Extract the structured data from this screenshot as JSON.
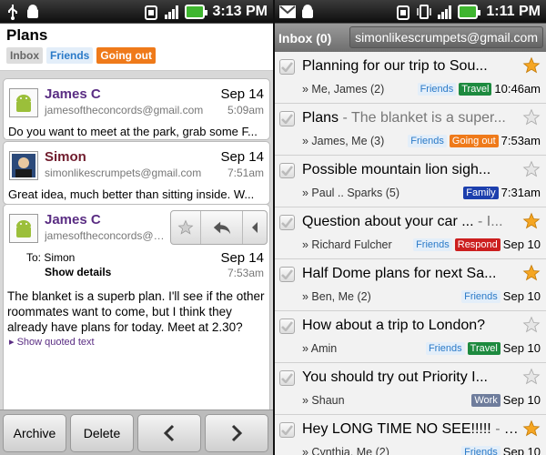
{
  "left": {
    "status": {
      "time": "3:13 PM"
    },
    "title": "Plans",
    "labels": [
      "Inbox",
      "Friends",
      "Going out"
    ],
    "messages": [
      {
        "name": "James C",
        "email": "jamesoftheconcords@gmail.com",
        "date": "Sep 14",
        "time": "5:09am",
        "snippet": "Do you want to meet at the park, grab some F..."
      },
      {
        "name": "Simon",
        "email": "simonlikescrumpets@gmail.com",
        "date": "Sep 14",
        "time": "7:51am",
        "snippet": "Great idea, much better than sitting inside. W..."
      }
    ],
    "open_message": {
      "name": "James C",
      "email": "jamesoftheconcords@g...",
      "to": "To: Simon",
      "show_details": "Show details",
      "date": "Sep 14",
      "time": "7:53am",
      "body": "The blanket is a superb plan. I'll see if the other roommates want to come, but I think they already have plans for today. Meet at 2.30?",
      "quoted": "▸ Show quoted text"
    },
    "bottom": {
      "archive": "Archive",
      "delete": "Delete"
    }
  },
  "right": {
    "status": {
      "time": "1:11 PM"
    },
    "inbox_title": "Inbox (0)",
    "account": "simonlikescrumpets@gmail.com",
    "threads": [
      {
        "subject": "Planning for our trip to Sou...",
        "snippet": "",
        "from": "» Me, James (2)",
        "labels": [
          {
            "text": "Friends",
            "cls": "tl-friends"
          },
          {
            "text": "Travel",
            "cls": "tl-travel"
          }
        ],
        "time": "10:46am",
        "starred": true
      },
      {
        "subject": "Plans",
        "snippet": " - The blanket is a super...",
        "from": "» James, Me (3)",
        "labels": [
          {
            "text": "Friends",
            "cls": "tl-friends"
          },
          {
            "text": "Going out",
            "cls": "tl-goingout"
          }
        ],
        "time": "7:53am",
        "starred": false
      },
      {
        "subject": "Possible mountain lion sigh...",
        "snippet": "",
        "from": "» Paul .. Sparks (5)",
        "labels": [
          {
            "text": "Family",
            "cls": "tl-family"
          }
        ],
        "time": "7:31am",
        "starred": false
      },
      {
        "subject": "Question about your car ...",
        "snippet": " - I...",
        "from": "» Richard Fulcher",
        "labels": [
          {
            "text": "Friends",
            "cls": "tl-friends"
          },
          {
            "text": "Respond",
            "cls": "tl-respond"
          }
        ],
        "time": "Sep 10",
        "starred": true
      },
      {
        "subject": "Half Dome plans for next Sa...",
        "snippet": "",
        "from": "» Ben, Me (2)",
        "labels": [
          {
            "text": "Friends",
            "cls": "tl-friends"
          }
        ],
        "time": "Sep 10",
        "starred": true
      },
      {
        "subject": "How about a trip to London?",
        "snippet": "",
        "from": "» Amin",
        "labels": [
          {
            "text": "Friends",
            "cls": "tl-friends"
          },
          {
            "text": "Travel",
            "cls": "tl-travel"
          }
        ],
        "time": "Sep 10",
        "starred": false
      },
      {
        "subject": "You should try out Priority I...",
        "snippet": "",
        "from": "» Shaun",
        "labels": [
          {
            "text": "Work",
            "cls": "tl-work"
          }
        ],
        "time": "Sep 10",
        "starred": false
      },
      {
        "subject": "Hey LONG TIME NO SEE!!!!!",
        "snippet": " - T...",
        "from": "» Cynthia, Me (2)",
        "labels": [
          {
            "text": "Friends",
            "cls": "tl-friends"
          }
        ],
        "time": "Sep 10",
        "starred": true
      }
    ]
  },
  "colors": {
    "star": "#f5a623",
    "purple_name": "#5a2d83",
    "label_friends": "#2a7ac8"
  }
}
